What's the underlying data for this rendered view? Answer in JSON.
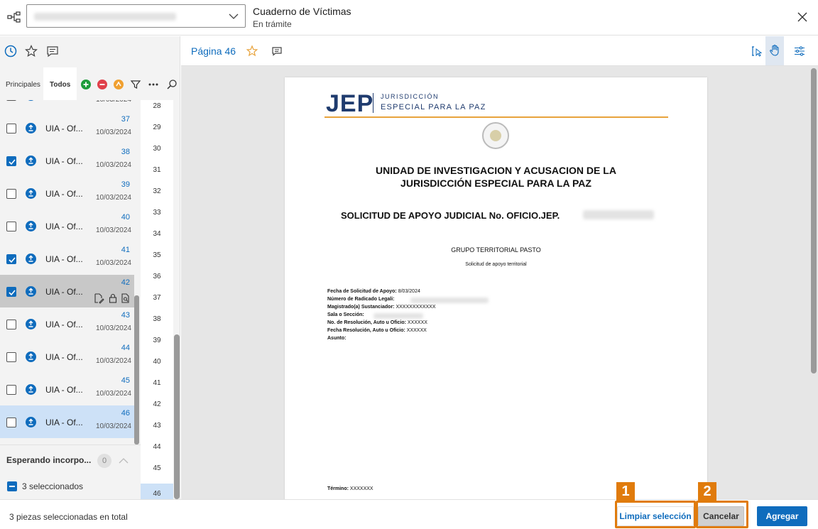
{
  "header": {
    "title": "Cuaderno de Víctimas",
    "subtitle": "En trámite"
  },
  "left_tabs": {
    "filter_tabs": [
      "Principales",
      "Todos"
    ],
    "active_filter": "Todos"
  },
  "list": {
    "rows": [
      {
        "label": "UIA - Of...",
        "num": "",
        "date": "10/03/2024",
        "checked": false
      },
      {
        "label": "UIA - Of...",
        "num": "37",
        "date": "10/03/2024",
        "checked": false
      },
      {
        "label": "UIA - Of...",
        "num": "38",
        "date": "10/03/2024",
        "checked": true
      },
      {
        "label": "UIA - Of...",
        "num": "39",
        "date": "10/03/2024",
        "checked": false
      },
      {
        "label": "UIA - Of...",
        "num": "40",
        "date": "10/03/2024",
        "checked": false
      },
      {
        "label": "UIA - Of...",
        "num": "41",
        "date": "10/03/2024",
        "checked": true
      },
      {
        "label": "UIA - Of...",
        "num": "42",
        "date": "",
        "checked": true
      },
      {
        "label": "UIA - Of...",
        "num": "43",
        "date": "10/03/2024",
        "checked": false
      },
      {
        "label": "UIA - Of...",
        "num": "44",
        "date": "10/03/2024",
        "checked": false
      },
      {
        "label": "UIA - Of...",
        "num": "45",
        "date": "10/03/2024",
        "checked": false
      },
      {
        "label": "UIA - Of...",
        "num": "46",
        "date": "10/03/2024",
        "checked": false
      }
    ],
    "waiting_label": "Esperando incorpo...",
    "waiting_count": "0",
    "selected_label": "3 seleccionados"
  },
  "pages": [
    "28",
    "29",
    "30",
    "31",
    "32",
    "33",
    "34",
    "35",
    "36",
    "37",
    "38",
    "39",
    "40",
    "41",
    "42",
    "43",
    "44",
    "45",
    "46"
  ],
  "viewer": {
    "page_label": "Página 46"
  },
  "document": {
    "logo": "JEP",
    "logo_sub1": "JURISDICCIÓN",
    "logo_sub2": "ESPECIAL PARA LA PAZ",
    "heading1_line1": "UNIDAD DE INVESTIGACION Y ACUSACION DE LA",
    "heading1_line2": "JURISDICCIÓN ESPECIAL PARA LA PAZ",
    "heading2": "SOLICITUD DE APOYO JUDICIAL No. OFICIO.JEP.",
    "group": "GRUPO TERRITORIAL PASTO",
    "request": "Solicitud de apoyo territorial",
    "fields": [
      {
        "label": "Fecha de Solicitud de Apoyo:",
        "value": "8/03/2024"
      },
      {
        "label": "Número de Radicado Legali:",
        "value": ""
      },
      {
        "label": "Magistrado(a) Sustanciador:",
        "value": "XXXXXXXXXXXX"
      },
      {
        "label": "Sala o Sección:",
        "value": ""
      },
      {
        "label": "No. de Resolución, Auto u Oficio:",
        "value": "XXXXXX"
      },
      {
        "label": "Fecha Resolución, Auto u Oficio:",
        "value": "XXXXXX"
      },
      {
        "label": "Asunto:",
        "value": ""
      }
    ],
    "term_label": "Término:",
    "term_value": "XXXXXXX"
  },
  "footer": {
    "status": "3 piezas seleccionadas en total",
    "clear_label": "Limpiar selección",
    "cancel_label": "Cancelar",
    "add_label": "Agregar"
  },
  "callouts": [
    "1",
    "2"
  ],
  "colors": {
    "accent": "#0f6cbd",
    "callout": "#e07b0c"
  }
}
